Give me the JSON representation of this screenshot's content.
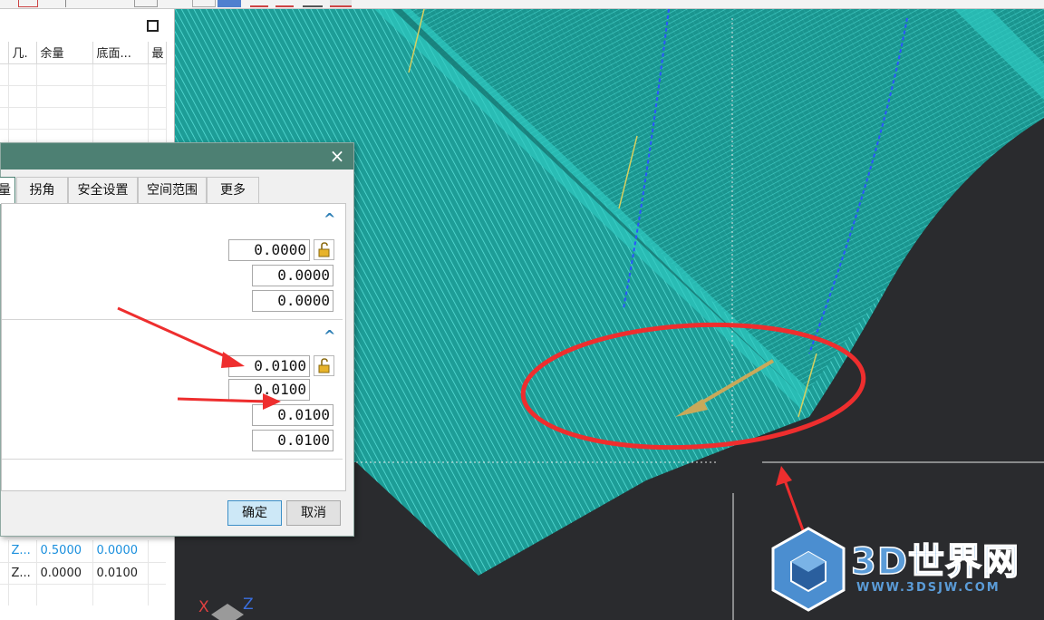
{
  "left_panel": {
    "columns": [
      "几.",
      "余量",
      "底面...",
      "最"
    ],
    "rows": [
      [
        "",
        "",
        "",
        ""
      ],
      [
        "",
        "",
        "",
        ""
      ],
      [
        "",
        "",
        "",
        ""
      ],
      [
        "",
        "",
        "",
        ""
      ],
      [
        "",
        "",
        "",
        ""
      ]
    ],
    "bottom_rows": [
      {
        "c0": "",
        "c1": "Z...",
        "c2": "0.5000",
        "c3": "0.0000",
        "blue": true
      },
      {
        "c0": "",
        "c1": "Z...",
        "c2": "0.0000",
        "c3": "0.0100",
        "blue": false
      }
    ]
  },
  "dialog": {
    "close_label": "×",
    "tabs": [
      {
        "label": "量",
        "active": true
      },
      {
        "label": "拐角",
        "active": false
      },
      {
        "label": "安全设置",
        "active": false
      },
      {
        "label": "空间范围",
        "active": false
      },
      {
        "label": "更多",
        "active": false
      }
    ],
    "group1": {
      "collapse_glyph": "^",
      "fields": [
        "0.0000",
        "0.0000",
        "0.0000"
      ]
    },
    "group2": {
      "collapse_glyph": "^",
      "fields": [
        "0.0100",
        "0.0100",
        "0.0100",
        "0.0100"
      ]
    },
    "ok_label": "确定",
    "cancel_label": "取消"
  },
  "viewport": {
    "axis_x": "X",
    "axis_z": "Z",
    "watermark_text": "3D世界网",
    "watermark_url": "WWW.3DSJW.COM"
  },
  "colors": {
    "surface": "#1fa7a0",
    "surface_edge": "#37e0d8",
    "background": "#2a2b2e",
    "dialog_title": "#4d8073",
    "annotation_red": "#ee2e2e",
    "tool_arrow": "#c9a95a"
  }
}
